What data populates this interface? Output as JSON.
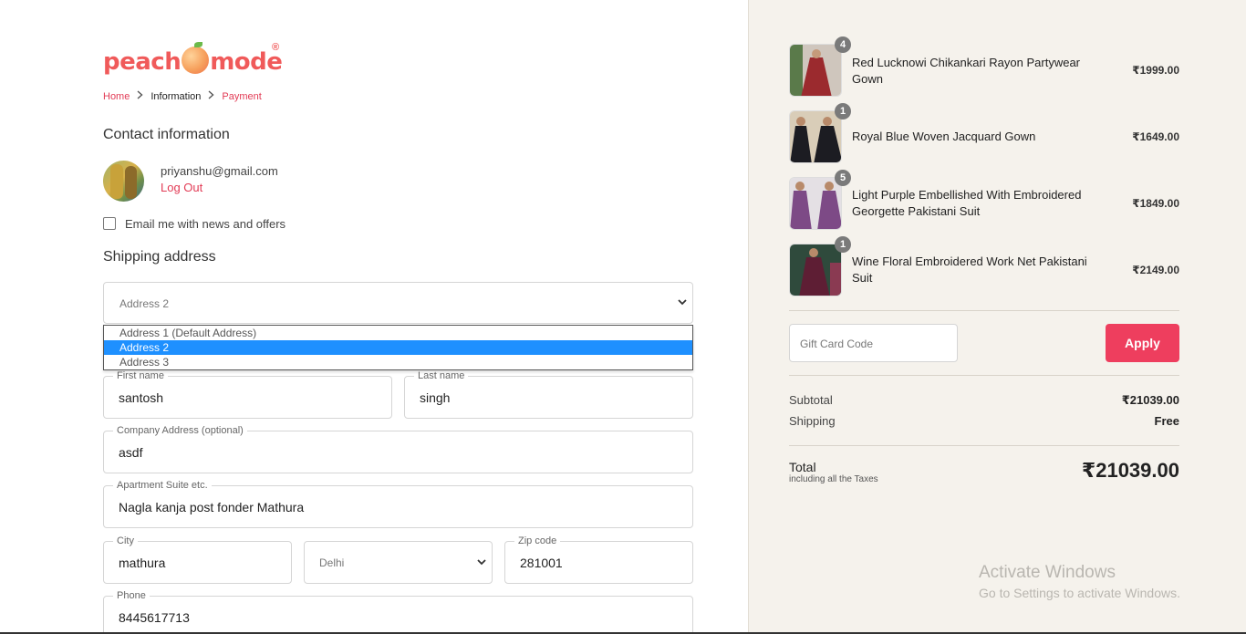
{
  "brand": {
    "logo_left": "peach",
    "logo_right": "mode",
    "reg": "®"
  },
  "breadcrumb": {
    "home": "Home",
    "information": "Information",
    "payment": "Payment"
  },
  "contact": {
    "title": "Contact information",
    "email": "priyanshu@gmail.com",
    "logout": "Log Out",
    "newsletter_label": "Email me with news and offers",
    "newsletter_checked": false
  },
  "shipping": {
    "title": "Shipping address",
    "address_select": "Address 2",
    "address_options": [
      "Address 1 (Default Address)",
      "Address 2",
      "Address 3"
    ],
    "first_name_label": "First name",
    "first_name": "santosh",
    "last_name_label": "Last name",
    "last_name": "singh",
    "company_label": "Company Address (optional)",
    "company": "asdf",
    "apartment_label": "Apartment Suite etc.",
    "apartment": "Nagla kanja post fonder Mathura",
    "city_label": "City",
    "city": "mathura",
    "state": "Delhi",
    "zip_label": "Zip code",
    "zip": "281001",
    "phone_label": "Phone",
    "phone": "8445617713"
  },
  "cart": {
    "items": [
      {
        "name": "Red Lucknowi Chikankari Rayon Partywear Gown",
        "qty": "4",
        "price": "₹1999.00",
        "thumb_color": "#9b2a2e"
      },
      {
        "name": "Royal Blue Woven Jacquard Gown",
        "qty": "1",
        "price": "₹1649.00",
        "thumb_color": "#1c1c22"
      },
      {
        "name": "Light Purple Embellished With Embroidered Georgette Pakistani Suit",
        "qty": "5",
        "price": "₹1849.00",
        "thumb_color": "#7d4a86"
      },
      {
        "name": "Wine Floral Embroidered Work Net Pakistani Suit",
        "qty": "1",
        "price": "₹2149.00",
        "thumb_color": "#5e1e34"
      }
    ],
    "gift_placeholder": "Gift Card Code",
    "apply_label": "Apply",
    "subtotal_label": "Subtotal",
    "subtotal": "₹21039.00",
    "shipping_label": "Shipping",
    "shipping": "Free",
    "total_label": "Total",
    "total_sub": "including all the Taxes",
    "total": "₹21039.00"
  },
  "watermark": {
    "title": "Activate Windows",
    "subtitle": "Go to Settings to activate Windows."
  },
  "colors": {
    "accent": "#e23b55",
    "apply": "#ee3e5e",
    "highlight": "#1e90ff",
    "panel": "#f5f2ec"
  }
}
